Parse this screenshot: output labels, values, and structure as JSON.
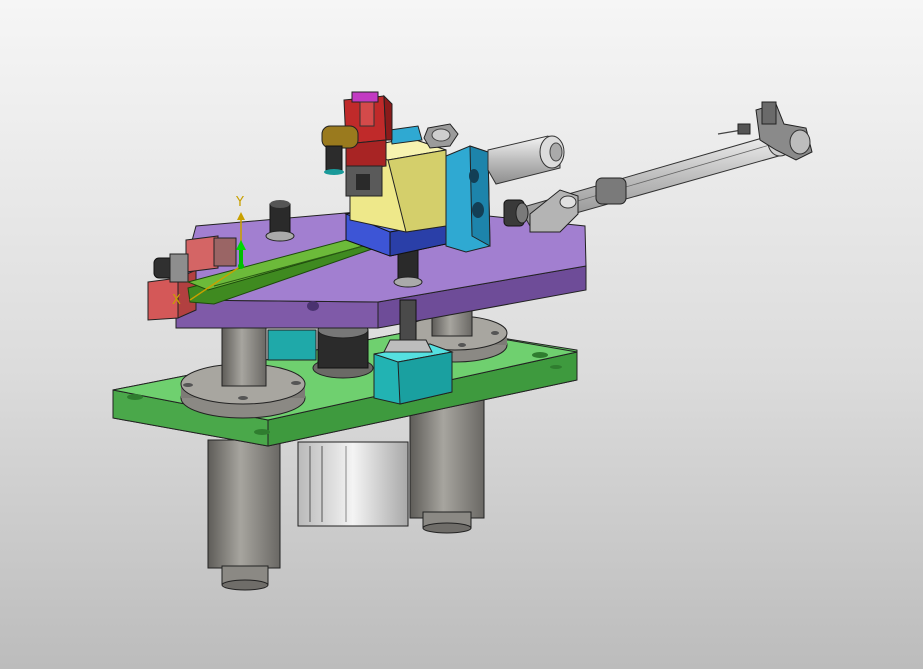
{
  "view": {
    "type": "cad-3d-assembly-viewport",
    "background_top": "#f6f6f6",
    "background_bottom": "#bcbcbc"
  },
  "triad": {
    "y_label": "Y",
    "x_label": "X",
    "y_color": "#c8a000",
    "z_color": "#00c000"
  },
  "part_colors": {
    "base_plate": "#5fc35f",
    "top_plate": "#a27fd0",
    "guide_rail": "#3f8a20",
    "slide_block": "#3d55d6",
    "upper_block": "#eee88a",
    "bracket": "#2fa9d2",
    "valve_head": "#c02a2a",
    "cylinder_body": "#c4c4c4",
    "columns": "#8a8882",
    "cyan_block": "#2ec9c9"
  }
}
